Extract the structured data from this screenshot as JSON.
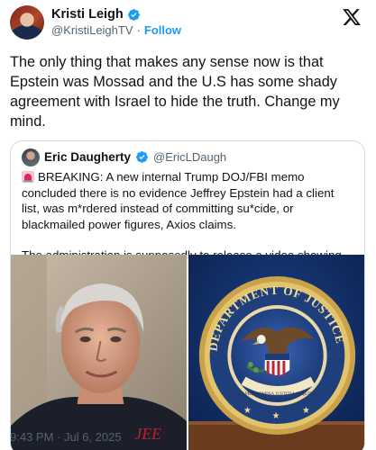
{
  "author": {
    "name": "Kristi Leigh",
    "handle": "@KristiLeighTV",
    "separator": "·",
    "follow_label": "Follow"
  },
  "tweet": {
    "text": "The only thing that makes any sense now is that Epstein was Mossad and the U.S has some shady agreement with Israel to hide the truth. Change my mind."
  },
  "quote": {
    "name": "Eric Daugherty",
    "handle": "@EricLDaugh",
    "paragraph1": "BREAKING: A new internal Trump DOJ/FBI memo concluded there is no evidence Jeffrey Epstein had a client list, was m*rdered instead of committing su*cide, or blackmailed power figures, Axios claims.",
    "paragraph2": "The administration is supposedly to release a video showing nobody entered the"
  },
  "footer": {
    "timestamp": "9:43 PM · Jul 6, 2025"
  },
  "icons": {
    "verified": "verified-badge-icon",
    "siren": "siren-emoji-icon",
    "platform": "x-logo-icon"
  },
  "seal": {
    "ring_text": "DEPARTMENT OF JUSTICE",
    "motto": "QUI PRO DOMINA JUSTITIA SEQUITUR"
  },
  "colors": {
    "accent": "#1d9bf0",
    "text": "#0f1419",
    "muted": "#536471",
    "border": "#cfd9de"
  }
}
